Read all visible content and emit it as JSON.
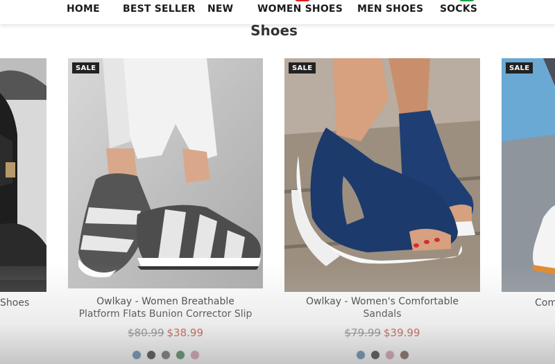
{
  "nav": {
    "items": [
      "HOME",
      "BEST SELLER",
      "NEW",
      "WOMEN SHOES",
      "MEN SHOES",
      "SOCKS"
    ]
  },
  "section": {
    "title": "Shoes"
  },
  "products": [
    {
      "title_line1": "Shoes",
      "title_line2": ""
    },
    {
      "sale": "SALE",
      "title_line1": "Owlkay - Women Breathable",
      "title_line2": "Platform Flats Bunion Corrector Slip",
      "old_price": "$80.99",
      "price": "$38.99",
      "swatches": [
        "#3b6d9a",
        "#111111",
        "#4a4a4a",
        "#1f6b3a",
        "#c98a96"
      ]
    },
    {
      "sale": "SALE",
      "title_line1": "Owlkay - Women's Comfortable",
      "title_line2": "Sandals",
      "old_price": "$79.99",
      "price": "$39.99",
      "swatches": [
        "#3b6d9a",
        "#111111",
        "#c98a96",
        "#5a3a28"
      ]
    },
    {
      "sale": "SALE",
      "title_line1": "Com",
      "title_line2": ""
    }
  ],
  "colors": {
    "sale_price": "#c0392b",
    "accent_red": "#e0201f",
    "accent_green": "#19a34a"
  }
}
